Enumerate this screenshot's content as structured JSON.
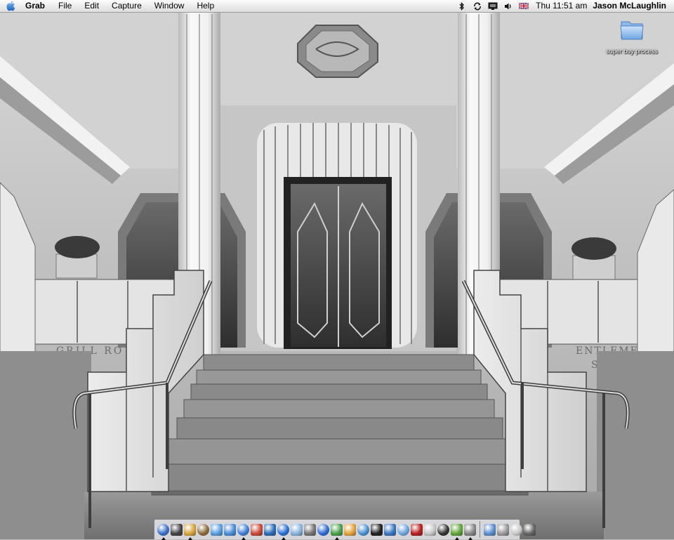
{
  "menubar": {
    "apple_icon": "apple-logo-icon",
    "app_name": "Grab",
    "menus": [
      "File",
      "Edit",
      "Capture",
      "Window",
      "Help"
    ],
    "status_icons": [
      "bluetooth-icon",
      "sync-icon",
      "display-icon",
      "volume-icon",
      "input-flag-uk-icon"
    ],
    "clock": "Thu 11:51 am",
    "user": "Jason McLaughlin"
  },
  "desktop": {
    "wallpaper": "art-deco-lobby-staircase-photo",
    "wallpaper_texts": [
      "GRILL RO",
      "ENTLEMENS",
      "SING"
    ],
    "folders": [
      {
        "label": "super buy process",
        "icon": "folder-icon"
      }
    ]
  },
  "dock": {
    "apps": [
      {
        "icon": "finder-icon",
        "running": true
      },
      {
        "icon": "dashboard-icon",
        "running": false
      },
      {
        "icon": "mail-icon",
        "running": true
      },
      {
        "icon": "address-book-icon",
        "running": false
      },
      {
        "icon": "network-utility-icon",
        "running": false
      },
      {
        "icon": "safari-icon",
        "running": false
      },
      {
        "icon": "internet-explorer-icon",
        "running": true
      },
      {
        "icon": "ical-icon",
        "running": false
      },
      {
        "icon": "itunes-sync-icon",
        "running": false
      },
      {
        "icon": "quicktime-icon",
        "running": true
      },
      {
        "icon": "preview-icon",
        "running": false
      },
      {
        "icon": "system-preferences-icon",
        "running": false
      },
      {
        "icon": "bbedit-icon",
        "running": false
      },
      {
        "icon": "iweb-icon",
        "running": true
      },
      {
        "icon": "fugu-icon",
        "running": false
      },
      {
        "icon": "finder-alt-icon",
        "running": false
      },
      {
        "icon": "terminal-icon",
        "running": false
      },
      {
        "icon": "photo-icon",
        "running": false
      },
      {
        "icon": "xcode-icon",
        "running": false
      },
      {
        "icon": "acrobat-icon",
        "running": false
      },
      {
        "icon": "image-editor-icon",
        "running": false
      },
      {
        "icon": "dvd-icon",
        "running": false
      },
      {
        "icon": "itunes-icon",
        "running": true
      },
      {
        "icon": "grab-icon",
        "running": true
      }
    ],
    "docs": [
      {
        "icon": "applications-folder-icon"
      },
      {
        "icon": "documents-stack-icon"
      },
      {
        "icon": "downloads-stack-icon"
      },
      {
        "icon": "trash-icon"
      }
    ],
    "colors": [
      "#3a6fc9",
      "#444",
      "#d9a640",
      "#8a6a3a",
      "#5a9fe0",
      "#4a90d9",
      "#3b7fd4",
      "#c94a3a",
      "#2c6db8",
      "#2a6fd1",
      "#8ab5e0",
      "#777",
      "#2e6ad1",
      "#4ba14a",
      "#e3a33b",
      "#4a8fd0",
      "#222",
      "#3a78c4",
      "#6aa4dd",
      "#b82020",
      "#c9c9c9",
      "#333",
      "#61a63b",
      "#888",
      "#5c8fd0",
      "#999",
      "#c8c8c8",
      "#666"
    ]
  }
}
